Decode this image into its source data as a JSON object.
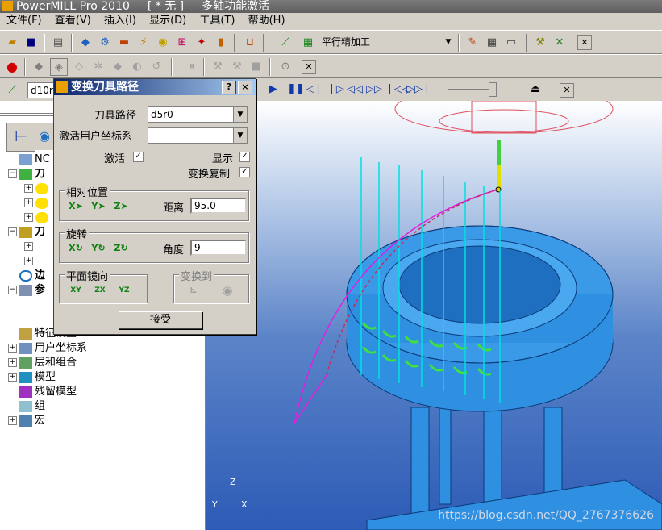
{
  "window": {
    "app_title": "PowerMILL Pro 2010",
    "project_label": "[ * 无 ]",
    "subtitle": "多轴功能激活"
  },
  "menu": [
    "文件(F)",
    "查看(V)",
    "插入(I)",
    "显示(D)",
    "工具(T)",
    "帮助(H)"
  ],
  "toolbar": {
    "strategy_label": "平行精加工"
  },
  "left_combo_value": "d10r",
  "tree": {
    "nc": "NC",
    "toolpaths": "刀",
    "tools": "刀",
    "boundary": "边",
    "params": "参",
    "features": "特征设置",
    "ucs": "用户坐标系",
    "layers": "层和组合",
    "model": "模型",
    "stock": "残留模型",
    "group": "组",
    "macro": "宏"
  },
  "dialog": {
    "title": "变换刀具路径",
    "help_btn": "?",
    "close_btn": "×",
    "toolpath_label": "刀具路径",
    "toolpath_value": "d5r0",
    "ucs_label": "激活用户坐标系",
    "ucs_value": "",
    "activate_label": "激活",
    "activate_checked": true,
    "show_label": "显示",
    "show_checked": true,
    "copy_label": "变换复制",
    "copy_checked": true,
    "relative_group": "相对位置",
    "distance_label": "距离",
    "distance_value": "95.0",
    "rotate_group": "旋转",
    "angle_label": "角度",
    "angle_value": "9",
    "mirror_group": "平面镜向",
    "transform_to_group": "变换到",
    "accept_label": "接受"
  },
  "axes": {
    "z": "Z",
    "y": "Y",
    "x": "X"
  },
  "watermark": "https://blog.csdn.net/QQ_2767376626",
  "colors": {
    "accent": "#0a246a",
    "viewport_bg": "#2d5bb6",
    "tire": "#2f8fe0",
    "toolpath": "#00e0e0"
  }
}
